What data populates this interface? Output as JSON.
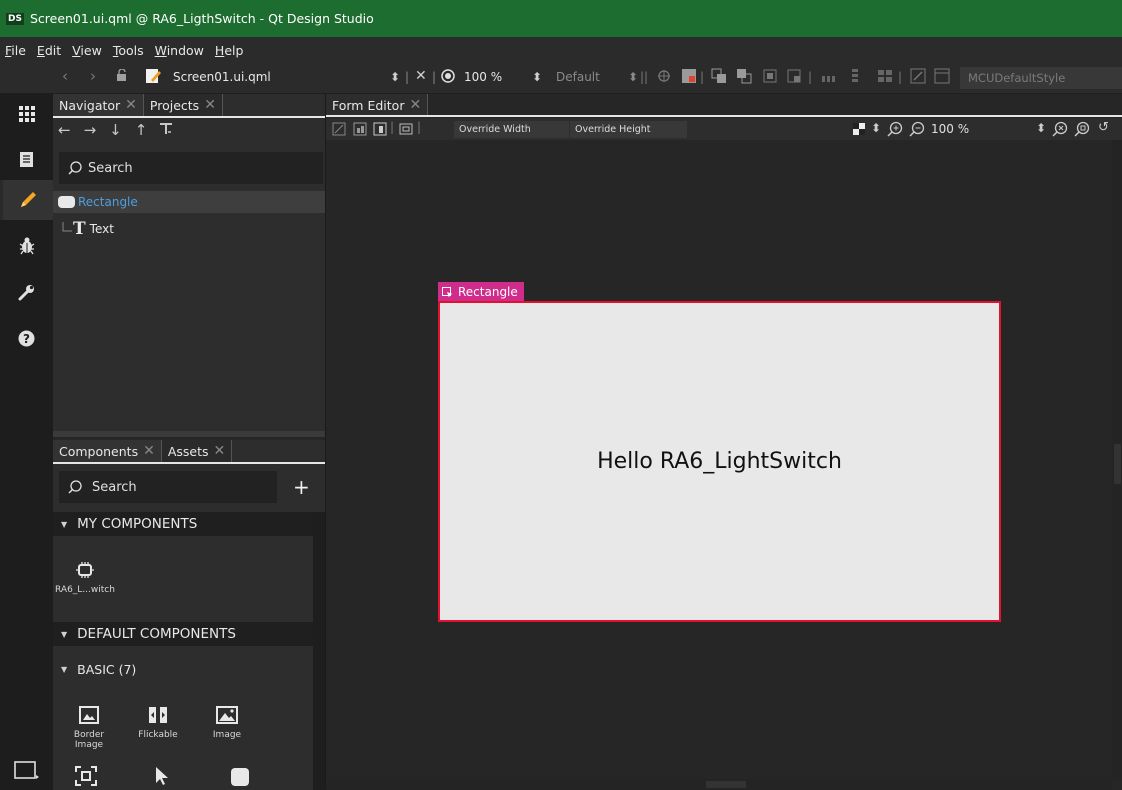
{
  "window": {
    "app_badge": "DS",
    "title": "Screen01.ui.qml @ RA6_LigthSwitch - Qt Design Studio"
  },
  "menu": [
    {
      "label": "File",
      "mnemonic": "F",
      "rest": "ile"
    },
    {
      "label": "Edit",
      "mnemonic": "E",
      "rest": "dit"
    },
    {
      "label": "View",
      "mnemonic": "V",
      "rest": "iew"
    },
    {
      "label": "Tools",
      "mnemonic": "T",
      "rest": "ools"
    },
    {
      "label": "Window",
      "mnemonic": "W",
      "rest": "indow"
    },
    {
      "label": "Help",
      "mnemonic": "H",
      "rest": "elp"
    }
  ],
  "toolbar": {
    "file_name": "Screen01.ui.qml",
    "zoom": "100 %",
    "state": "Default",
    "style": "MCUDefaultStyle"
  },
  "navigator": {
    "tabs": [
      {
        "label": "Navigator",
        "close": "✕"
      },
      {
        "label": "Projects",
        "close": "✕"
      }
    ],
    "search_placeholder": "Search",
    "tree": [
      {
        "label": "Rectangle",
        "type": "rectangle",
        "selected": true
      },
      {
        "label": "Text",
        "type": "text",
        "selected": false
      }
    ]
  },
  "components": {
    "tabs": [
      {
        "label": "Components",
        "close": "✕"
      },
      {
        "label": "Assets",
        "close": "✕"
      }
    ],
    "search_placeholder": "Search",
    "add_label": "+",
    "my_components_title": "MY COMPONENTS",
    "my_components": [
      {
        "label": "RA6_L...witch",
        "icon": "chip-icon"
      }
    ],
    "default_components_title": "DEFAULT COMPONENTS",
    "basic_title": "BASIC (7)",
    "basic": [
      {
        "label": "Border Image",
        "icon": "border-image-icon"
      },
      {
        "label": "Flickable",
        "icon": "flickable-icon"
      },
      {
        "label": "Image",
        "icon": "image-icon"
      }
    ]
  },
  "editor": {
    "tab": {
      "label": "Form Editor",
      "close": "✕"
    },
    "override_width": "Override Width",
    "override_height": "Override Height",
    "zoom": "100 %",
    "selection_label": "Rectangle",
    "canvas_text": "Hello RA6_LightSwitch"
  },
  "colors": {
    "title_bar": "#1c6d2f",
    "selection_badge": "#cf2c8c",
    "selection_border": "#e3112f",
    "tree_selected_text": "#4d9fe0"
  }
}
